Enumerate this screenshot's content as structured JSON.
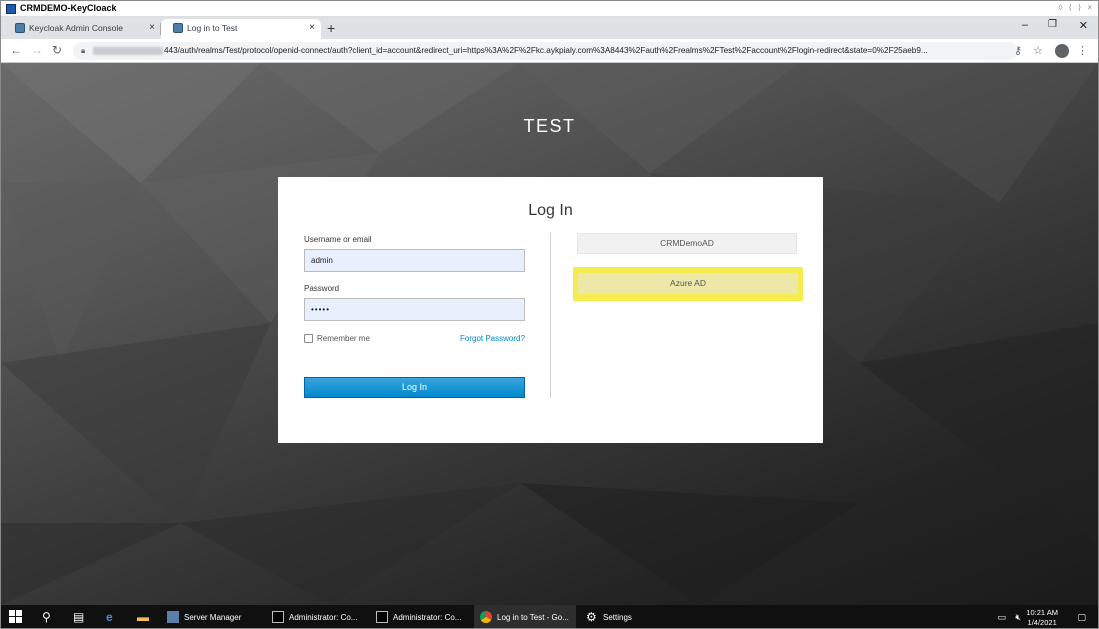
{
  "window": {
    "title": "CRMDEMO-KeyCloack",
    "pin_controls": "◊ ⟨ ⟩ ×"
  },
  "browser": {
    "tabs": [
      {
        "label": "Keycloak Admin Console",
        "close": "×"
      },
      {
        "label": "Log in to Test",
        "close": "×"
      }
    ],
    "new_tab": "+",
    "window_controls": {
      "minimize": "–",
      "maximize": "❐",
      "close": "✕"
    },
    "nav": {
      "back": "←",
      "forward": "→",
      "reload": "↻"
    },
    "url_visible": "443/auth/realms/Test/protocol/openid-connect/auth?client_id=account&redirect_uri=https%3A%2F%2Fkc.aykpialy.com%3A8443%2Fauth%2Frealms%2FTest%2Faccount%2Flogin-redirect&state=0%2F25aeb9...",
    "toolbar": {
      "key": "⚷",
      "star": "☆",
      "menu": "⋮"
    }
  },
  "page": {
    "realm_name": "TEST",
    "card_title": "Log In",
    "username_label": "Username or email",
    "username_value": "admin",
    "password_label": "Password",
    "password_value": "•••••",
    "remember_me": "Remember me",
    "forgot_password": "Forgot Password?",
    "login_button": "Log In",
    "identity_providers": [
      "CRMDemoAD",
      "Azure AD"
    ],
    "highlight_color": "#f4ed4f"
  },
  "taskbar": {
    "items": [
      {
        "label": "Server Manager"
      },
      {
        "label": "Administrator: Co..."
      },
      {
        "label": "Administrator: Co..."
      },
      {
        "label": "Log in to Test - Go..."
      },
      {
        "label": "Settings"
      }
    ],
    "time": "10:21 AM",
    "date": "1/4/2021"
  }
}
